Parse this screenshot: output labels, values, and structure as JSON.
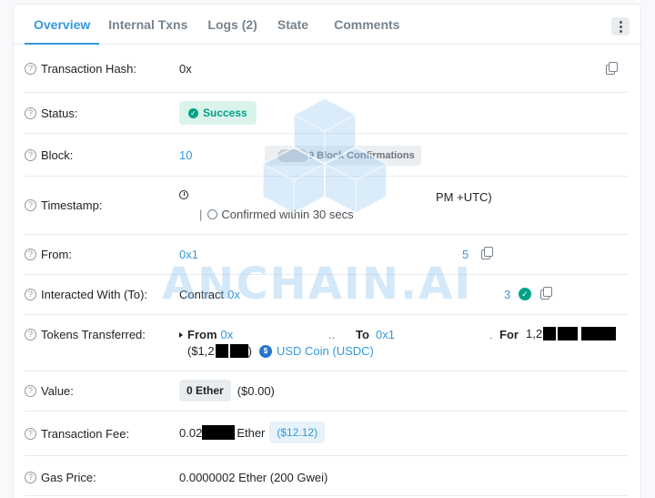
{
  "tabs": [
    {
      "label": "Overview"
    },
    {
      "label": "Internal Txns"
    },
    {
      "label": "Logs (2)"
    },
    {
      "label": "State"
    },
    {
      "label": "Comments"
    }
  ],
  "rows": {
    "hash": {
      "label": "Transaction Hash:",
      "value": "0x"
    },
    "status": {
      "label": "Status:",
      "value": "Success"
    },
    "block": {
      "label": "Block:",
      "value": "10",
      "confirmations": "9 Block Confirmations"
    },
    "timestamp": {
      "label": "Timestamp:",
      "value_end": "PM +UTC)",
      "confirmed": "Confirmed within 30 secs",
      "separator": "|"
    },
    "from": {
      "label": "From:",
      "value_start": "0x1",
      "value_end": "5"
    },
    "interacted": {
      "label": "Interacted With (To):",
      "prefix": "Contract",
      "value_start": "0x",
      "value_end": "3"
    },
    "tokens": {
      "label": "Tokens Transferred:",
      "from_label": "From",
      "from_value": "0x",
      "dots": "..",
      "to_label": "To",
      "to_value": "0x1",
      "dot": ".",
      "for_label": "For",
      "amount_start": "1,2",
      "usd_start": "($1,2",
      "usd_end": ")",
      "token_name": "USD Coin (USDC)"
    },
    "value": {
      "label": "Value:",
      "chip": "0 Ether",
      "usd": "($0.00)"
    },
    "fee": {
      "label": "Transaction Fee:",
      "value_start": "0.02",
      "value_end": "Ether",
      "usd": "($12.12)"
    },
    "gas": {
      "label": "Gas Price:",
      "value": "0.0000002 Ether (200 Gwei)"
    }
  },
  "watermark": "ANCHAIN.AI",
  "colors": {
    "accent": "#3498db",
    "success": "#00a186",
    "border": "#e7eaf3"
  }
}
